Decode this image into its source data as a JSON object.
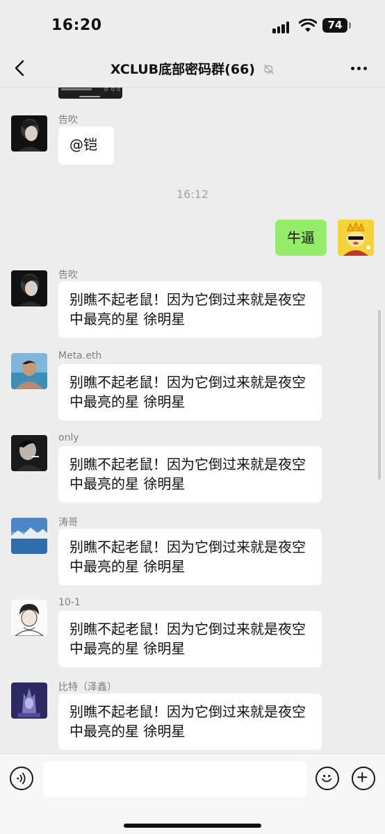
{
  "status_bar": {
    "time": "16:20",
    "battery": "74"
  },
  "nav": {
    "title": "XCLUB底部密码群(66)",
    "muted": true
  },
  "messages_top": [
    {
      "sender": "告吹",
      "text": "@铠"
    }
  ],
  "time_divider": "16:12",
  "self_message": {
    "text": "牛逼"
  },
  "messages": [
    {
      "sender": "告吹",
      "text": "别瞧不起老鼠！因为它倒过来就是夜空中最亮的星 徐明星"
    },
    {
      "sender": "Meta.eth",
      "text": "别瞧不起老鼠！因为它倒过来就是夜空中最亮的星 徐明星"
    },
    {
      "sender": "only",
      "text": "别瞧不起老鼠！因为它倒过来就是夜空中最亮的星 徐明星"
    },
    {
      "sender": "涛哥",
      "text": "别瞧不起老鼠！因为它倒过来就是夜空中最亮的星 徐明星"
    },
    {
      "sender": "10-1",
      "text": "别瞧不起老鼠！因为它倒过来就是夜空中最亮的星 徐明星"
    },
    {
      "sender": "比特（泽鑫）",
      "text": "别瞧不起老鼠！因为它倒过来就是夜空中最亮的星 徐明星"
    }
  ],
  "input": {
    "value": ""
  },
  "icons": {
    "back": "chevron-left-icon",
    "mute": "bell-off-icon",
    "more": "more-dots-icon",
    "voice": "voice-icon",
    "emoji": "emoji-icon",
    "plus": "plus-icon"
  },
  "colors": {
    "self_bubble": "#95ec69",
    "background": "#ededed"
  }
}
